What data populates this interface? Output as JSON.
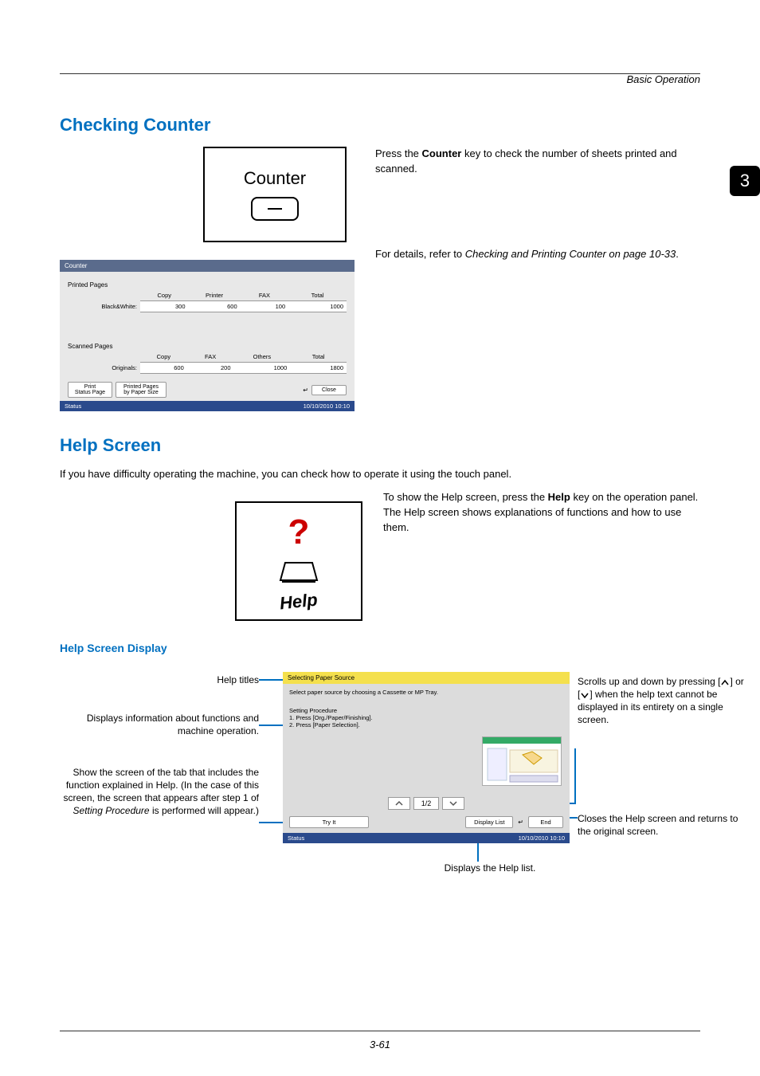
{
  "page": {
    "running_head": "Basic Operation",
    "footer_page": "3-61",
    "chapter_tab": "3"
  },
  "checking_counter": {
    "title": "Checking Counter",
    "box_label": "Counter",
    "para1_pre": "Press the ",
    "para1_bold": "Counter",
    "para1_post": " key to check the number of sheets printed and scanned.",
    "para2_pre": "For details, refer to ",
    "para2_italic": "Checking and Printing Counter on page 10-33",
    "para2_post": "."
  },
  "counter_panel": {
    "bar_title": "Counter",
    "printed_label": "Printed Pages",
    "printed_headers": [
      "Copy",
      "Printer",
      "FAX",
      "Total"
    ],
    "printed_row_label": "Black&White:",
    "printed_row": [
      "300",
      "600",
      "100",
      "1000"
    ],
    "scanned_label": "Scanned Pages",
    "scanned_headers": [
      "Copy",
      "FAX",
      "Others",
      "Total"
    ],
    "scanned_row_label": "Originals:",
    "scanned_row": [
      "600",
      "200",
      "1000",
      "1800"
    ],
    "btn_print": "Print\nStatus Page",
    "btn_printed_pages": "Printed Pages\nby Paper Size",
    "btn_close": "Close",
    "status_label": "Status",
    "status_time": "10/10/2010    10:10"
  },
  "help": {
    "title": "Help Screen",
    "intro": "If you have difficulty operating the machine, you can check how to operate it using the touch panel.",
    "para_pre": "To show the Help screen, press the ",
    "para_bold": "Help",
    "para_post": " key on the operation panel. The Help screen shows explanations of functions and how to use them.",
    "box_label": "Help",
    "sub_title": "Help Screen Display"
  },
  "help_panel": {
    "title": "Selecting Paper Source",
    "text": "Select paper source by choosing a Cassette or MP Tray.",
    "proc_title": "Setting Procedure",
    "proc_line1": "1. Press [Org./Paper/Finishing].",
    "proc_line2": "2. Press [Paper Selection].",
    "pager": "1/2",
    "btn_try": "Try It",
    "btn_list": "Display List",
    "btn_end": "End",
    "status_label": "Status",
    "status_time": "10/10/2010    10:10"
  },
  "callouts": {
    "titles": "Help titles",
    "info": "Displays information about functions and machine operation.",
    "tab_pre": "Show the screen of the tab that includes the function explained in Help. (In the case of this screen, the screen that appears after step 1 of ",
    "tab_italic": "Setting Procedure",
    "tab_post": " is performed will appear.)",
    "scroll": "Scrolls up and down by pressing [      ] or [      ] when the help text cannot be displayed in its entirety on a single screen.",
    "close": "Closes the Help screen and returns to the original screen.",
    "display_list": "Displays the Help list."
  }
}
